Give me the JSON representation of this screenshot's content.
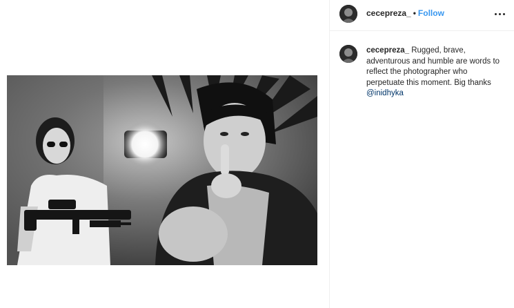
{
  "post": {
    "username": "cecepreza_",
    "separator": "•",
    "follow_label": "Follow",
    "more_icon": "more-horizontal-icon"
  },
  "caption": {
    "username": "cecepreza_",
    "text": "Rugged, brave, adventurous and humble are words to reflect the photographer who perpetuate this moment. Big thanks",
    "mention": "@inidhyka"
  },
  "colors": {
    "accent": "#3897f0",
    "mention": "#003569",
    "divider": "#efefef"
  }
}
